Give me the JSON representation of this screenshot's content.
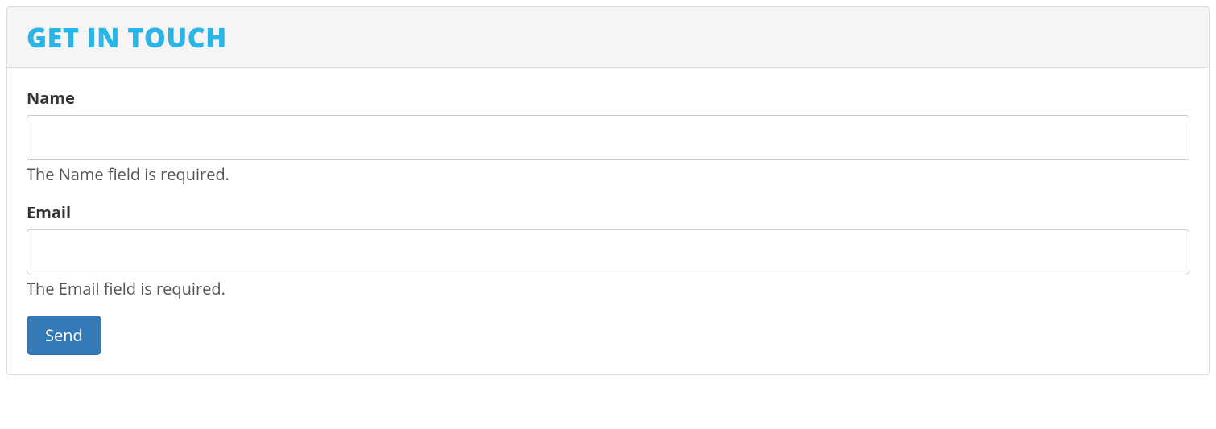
{
  "panel": {
    "title": "GET IN TOUCH"
  },
  "form": {
    "name": {
      "label": "Name",
      "value": "",
      "error": "The Name field is required."
    },
    "email": {
      "label": "Email",
      "value": "",
      "error": "The Email field is required."
    },
    "submit_label": "Send"
  }
}
